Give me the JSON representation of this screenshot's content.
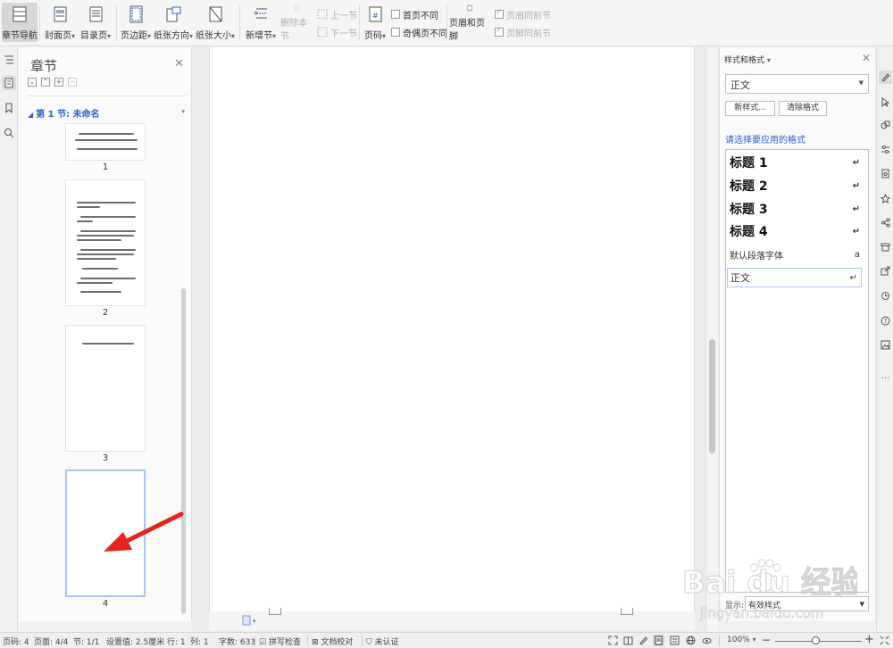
{
  "ribbon": {
    "chapter_nav": "章节导航",
    "cover": "封面页",
    "toc": "目录页",
    "margins": "页边距",
    "orientation": "纸张方向",
    "size": "纸张大小",
    "new_section": "新增节",
    "delete_section": "删除本节",
    "prev_section": "上一节",
    "next_section": "下一节",
    "page_number": "页码",
    "first_page_diff": "首页不同",
    "odd_even_diff": "奇偶页不同",
    "header_footer": "页眉和页脚",
    "header_same_prev": "页眉同前节",
    "footer_same_prev": "页脚同前节"
  },
  "chapter_panel": {
    "title": "章节",
    "section": "第 1 节: 未命名",
    "pages": [
      "1",
      "2",
      "3",
      "4"
    ]
  },
  "style_panel": {
    "title": "样式和格式",
    "current_style": "正文",
    "new_style": "新样式...",
    "clear_format": "清除格式",
    "hint": "请选择要应用的格式",
    "styles": [
      {
        "label": "标题  1",
        "mark": "↵"
      },
      {
        "label": "标题  2",
        "mark": "↵"
      },
      {
        "label": "标题  3",
        "mark": "↵"
      },
      {
        "label": "标题  4",
        "mark": "↵"
      },
      {
        "label": "默认段落字体",
        "mark": "a"
      },
      {
        "label": "正文",
        "mark": "↵"
      }
    ],
    "show_label": "显示:",
    "show_value": "有效样式"
  },
  "status": {
    "page_num": "页码: 4",
    "pages": "页面: 4/4",
    "section": "节: 1/1",
    "setting": "设置值: 2.5厘米",
    "row": "行: 1",
    "col": "列: 1",
    "words": "字数: 633",
    "spell": "拼写检查",
    "proof": "文档校对",
    "auth": "未认证",
    "zoom": "100%",
    "minus": "−",
    "plus": "+"
  },
  "watermark": {
    "brand": "Bai du 经验",
    "url": "jingyan.baidu.com"
  },
  "colors": {
    "accent_blue": "#2a62c9",
    "arrow_red": "#e8231e"
  }
}
